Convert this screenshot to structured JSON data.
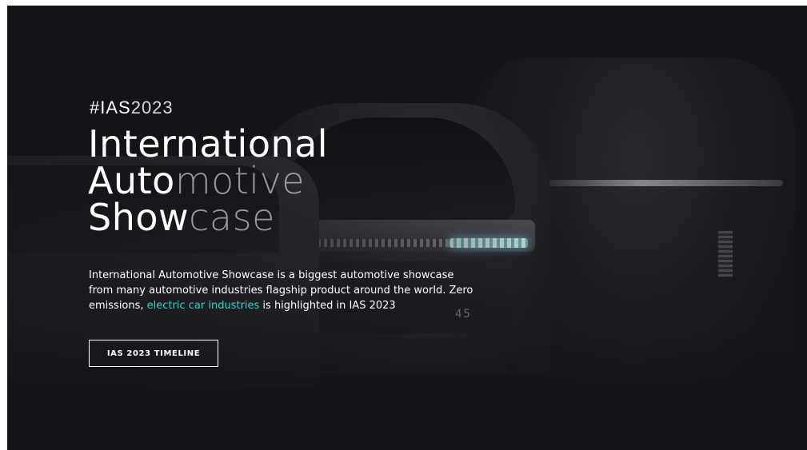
{
  "hero": {
    "hashtag_prefix": "#IAS",
    "hashtag_year": "2023",
    "title_line1": "International",
    "title_line2_bold": "Auto",
    "title_line2_thin": "motive",
    "title_line3_bold": "Show",
    "title_line3_thin": "case",
    "description_part1": "International Automotive Showcase is a biggest automotive showcase from many automotive industries flagship product around the world. Zero emissions, ",
    "description_highlight": "electric car industries",
    "description_part2": " is highlighted in IAS 2023",
    "cta_label": "IAS 2023 TIMELINE",
    "car_badge": "45"
  },
  "colors": {
    "background": "#141418",
    "highlight": "#33d2c6",
    "text": "#ffffff"
  }
}
